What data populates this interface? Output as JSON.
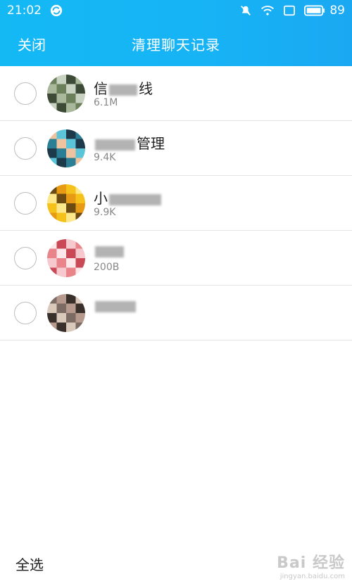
{
  "status_bar": {
    "time": "21:02",
    "battery": "89",
    "icons": [
      "sync-icon",
      "mute-icon",
      "wifi-icon",
      "screen-icon",
      "battery-icon"
    ]
  },
  "nav": {
    "close_label": "关闭",
    "title": "清理聊天记录"
  },
  "contacts": [
    {
      "name_visible": "信",
      "name_tail": "线",
      "size": "6.1M",
      "avatar_colors": [
        "#6b7f5a",
        "#a9b79a",
        "#3d4a36",
        "#c9d2c0"
      ]
    },
    {
      "name_visible": "",
      "name_tail": "管理",
      "size": "9.4K",
      "avatar_colors": [
        "#5cc4d8",
        "#f0c3a0",
        "#2a7f95",
        "#1d3a4a"
      ]
    },
    {
      "name_visible": "小",
      "name_tail": "",
      "size": "9.9K",
      "avatar_colors": [
        "#f5c21c",
        "#e79a13",
        "#6b4b12",
        "#fce78a"
      ]
    },
    {
      "name_visible": "",
      "name_tail": "",
      "size": "200B",
      "avatar_colors": [
        "#e8848a",
        "#f6c9cf",
        "#c94a56",
        "#fde7ea"
      ]
    },
    {
      "name_visible": "",
      "name_tail": "",
      "size": "",
      "avatar_colors": [
        "#7b6b62",
        "#d9c9bb",
        "#3a302b",
        "#b79a8e"
      ]
    }
  ],
  "footer": {
    "select_all_label": "全选"
  },
  "watermark": {
    "logo": "Bai 经验",
    "url": "jingyan.baidu.com"
  },
  "colors": {
    "header": "#17b3f5",
    "divider": "#e4e4e4",
    "radio_border": "#bdbdbd"
  }
}
